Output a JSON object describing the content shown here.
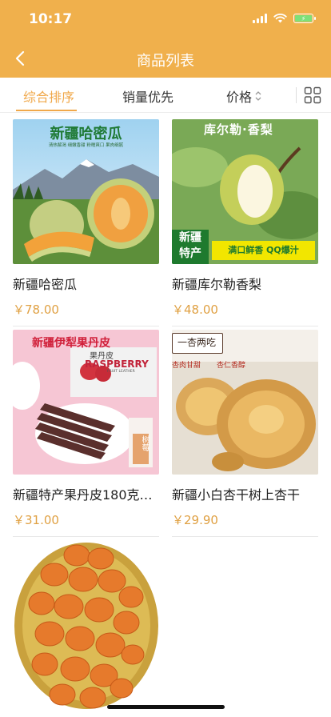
{
  "status": {
    "time": "10:17"
  },
  "nav": {
    "title": "商品列表"
  },
  "tabs": {
    "comprehensive": "综合排序",
    "sales": "销量优先",
    "price": "价格"
  },
  "products": [
    {
      "name": "新疆哈密瓜",
      "price": "￥78.00",
      "banner": "新疆哈密瓜",
      "banner_sub": "清热解渴 细嫩香甜 粉糯爽口 果肉细腻"
    },
    {
      "name": "新疆库尔勒香梨",
      "price": "￥48.00",
      "banner": "库尔勒·香梨",
      "badge1": "新疆",
      "badge2": "特产",
      "slogan": "满口鲜香 QQ爆汁"
    },
    {
      "name": "新疆特产果丹皮180克…",
      "price": "￥31.00",
      "banner": "新疆伊犁果丹皮",
      "box_brand": "果丹皮",
      "box_en": "RASPBERRY",
      "box_sub": "FRUIT LEATHER",
      "box_tag": "树莓"
    },
    {
      "name": "新疆小白杏干树上杏干",
      "price": "￥29.90",
      "banner": "一杏两吃",
      "banner_sub1": "杏肉甘甜",
      "banner_sub2": "杏仁香醇"
    },
    {
      "name": "",
      "price": ""
    }
  ],
  "colors": {
    "brand": "#f0b04c",
    "accent": "#f0a84a",
    "price": "#e0a144"
  },
  "icons": {
    "back": "chevron-left-icon",
    "sort": "sort-arrows-icon",
    "grid": "grid-view-icon",
    "wifi": "wifi-icon",
    "signal": "signal-icon",
    "battery": "battery-charging-icon"
  }
}
